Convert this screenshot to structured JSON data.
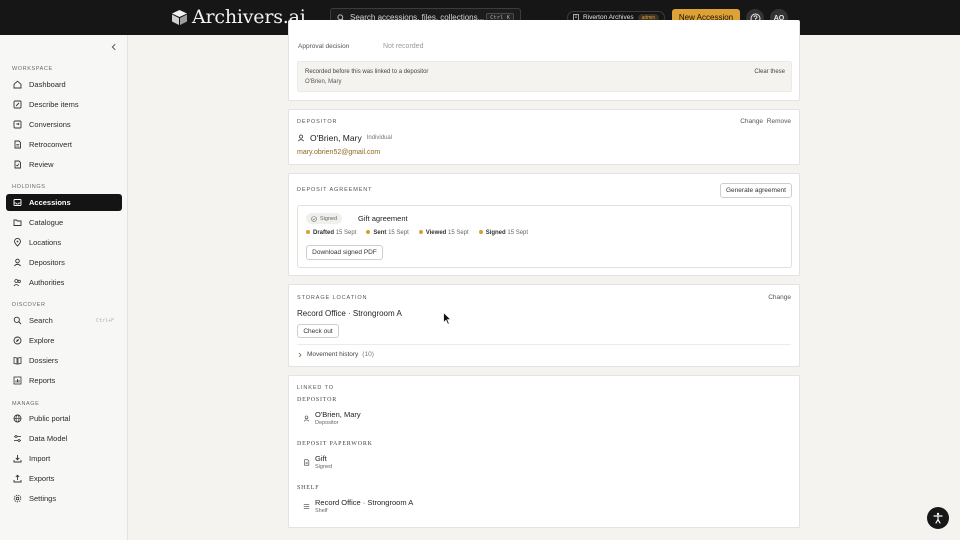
{
  "topbar": {
    "logo_text": "Archivers.ai",
    "search_placeholder": "Search accessions, files, collections...",
    "search_shortcut": "Ctrl K",
    "org_name": "Riverton Archives",
    "org_role": "admin",
    "new_button": "New Accession",
    "help": "?",
    "avatar": "AQ"
  },
  "sidebar": {
    "workspace_title": "WORKSPACE",
    "workspace": [
      "Dashboard",
      "Describe items",
      "Conversions",
      "Retroconvert",
      "Review"
    ],
    "holdings_title": "HOLDINGS",
    "holdings": [
      "Accessions",
      "Catalogue",
      "Locations",
      "Depositors",
      "Authorities"
    ],
    "discover_title": "DISCOVER",
    "discover": [
      "Search",
      "Explore",
      "Dossiers",
      "Reports"
    ],
    "search_shortcut": "Ctrl+F",
    "manage_title": "MANAGE",
    "manage": [
      "Public portal",
      "Data Model",
      "Import",
      "Exports",
      "Settings"
    ]
  },
  "approval": {
    "label": "Approval decision",
    "value": "Not recorded",
    "note_title": "Recorded before this was linked to a depositor",
    "note_name": "O'Brien, Mary",
    "clear_link": "Clear these"
  },
  "depositor": {
    "section_title": "DEPOSITOR",
    "change": "Change",
    "remove": "Remove",
    "name": "O'Brien, Mary",
    "type": "Individual",
    "email": "mary.obrien52@gmail.com"
  },
  "agreement": {
    "section_title": "DEPOSIT AGREEMENT",
    "generate_button": "Generate agreement",
    "status_badge": "Signed",
    "title": "Gift agreement",
    "steps": [
      {
        "label": "Drafted",
        "date": "15 Sept"
      },
      {
        "label": "Sent",
        "date": "15 Sept"
      },
      {
        "label": "Viewed",
        "date": "15 Sept"
      },
      {
        "label": "Signed",
        "date": "15 Sept"
      }
    ],
    "download_button": "Download signed PDF"
  },
  "storage": {
    "section_title": "STORAGE LOCATION",
    "change": "Change",
    "location": "Record Office · Strongroom A",
    "checkout_button": "Check out",
    "history_label": "Movement history",
    "history_count": "(10)"
  },
  "linked": {
    "section_title": "LINKED TO",
    "depositor_heading": "DEPOSITOR",
    "depositor_name": "O'Brien, Mary",
    "depositor_sub": "Depositor",
    "paperwork_heading": "DEPOSIT PAPERWORK",
    "paperwork_name": "Gift",
    "paperwork_sub": "Signed",
    "shelf_heading": "SHELF",
    "shelf_name": "Record Office · Strongroom A",
    "shelf_sub": "Shelf"
  },
  "colors": {
    "accent": "#dca236",
    "link": "#8a6a1f",
    "topbar": "#161616"
  }
}
